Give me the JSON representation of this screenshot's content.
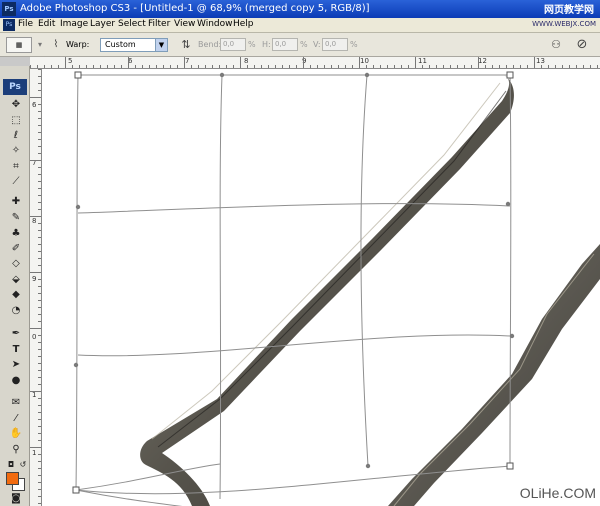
{
  "window": {
    "title": "Adobe Photoshop CS3 - [Untitled-1 @ 68,9% (merged copy 5, RGB/8)]",
    "app_icon": "Ps",
    "watermark": "网页教学网"
  },
  "menu": {
    "items": [
      "File",
      "Edit",
      "Image",
      "Layer",
      "Select",
      "Filter",
      "View",
      "Window",
      "Help"
    ],
    "watermark": "WWW.WEBJX.COM"
  },
  "options": {
    "warp_label": "Warp:",
    "warp_value": "Custom",
    "bend_label": "Bend:",
    "bend_value": "0,0",
    "h_label": "H:",
    "h_value": "0,0",
    "v_label": "V:",
    "v_value": "0,0",
    "percent": "%"
  },
  "toolbox": {
    "logo": "Ps",
    "foreground_color": "#f26b0f",
    "background_color": "#ffffff"
  },
  "rulers": {
    "top": [
      "5",
      "6",
      "7",
      "8",
      "9",
      "10",
      "11",
      "12",
      "13"
    ],
    "left": [
      "6",
      "7",
      "8",
      "9",
      "0",
      "1",
      "1"
    ]
  },
  "footer": {
    "watermark": "OLiHe.COM"
  }
}
